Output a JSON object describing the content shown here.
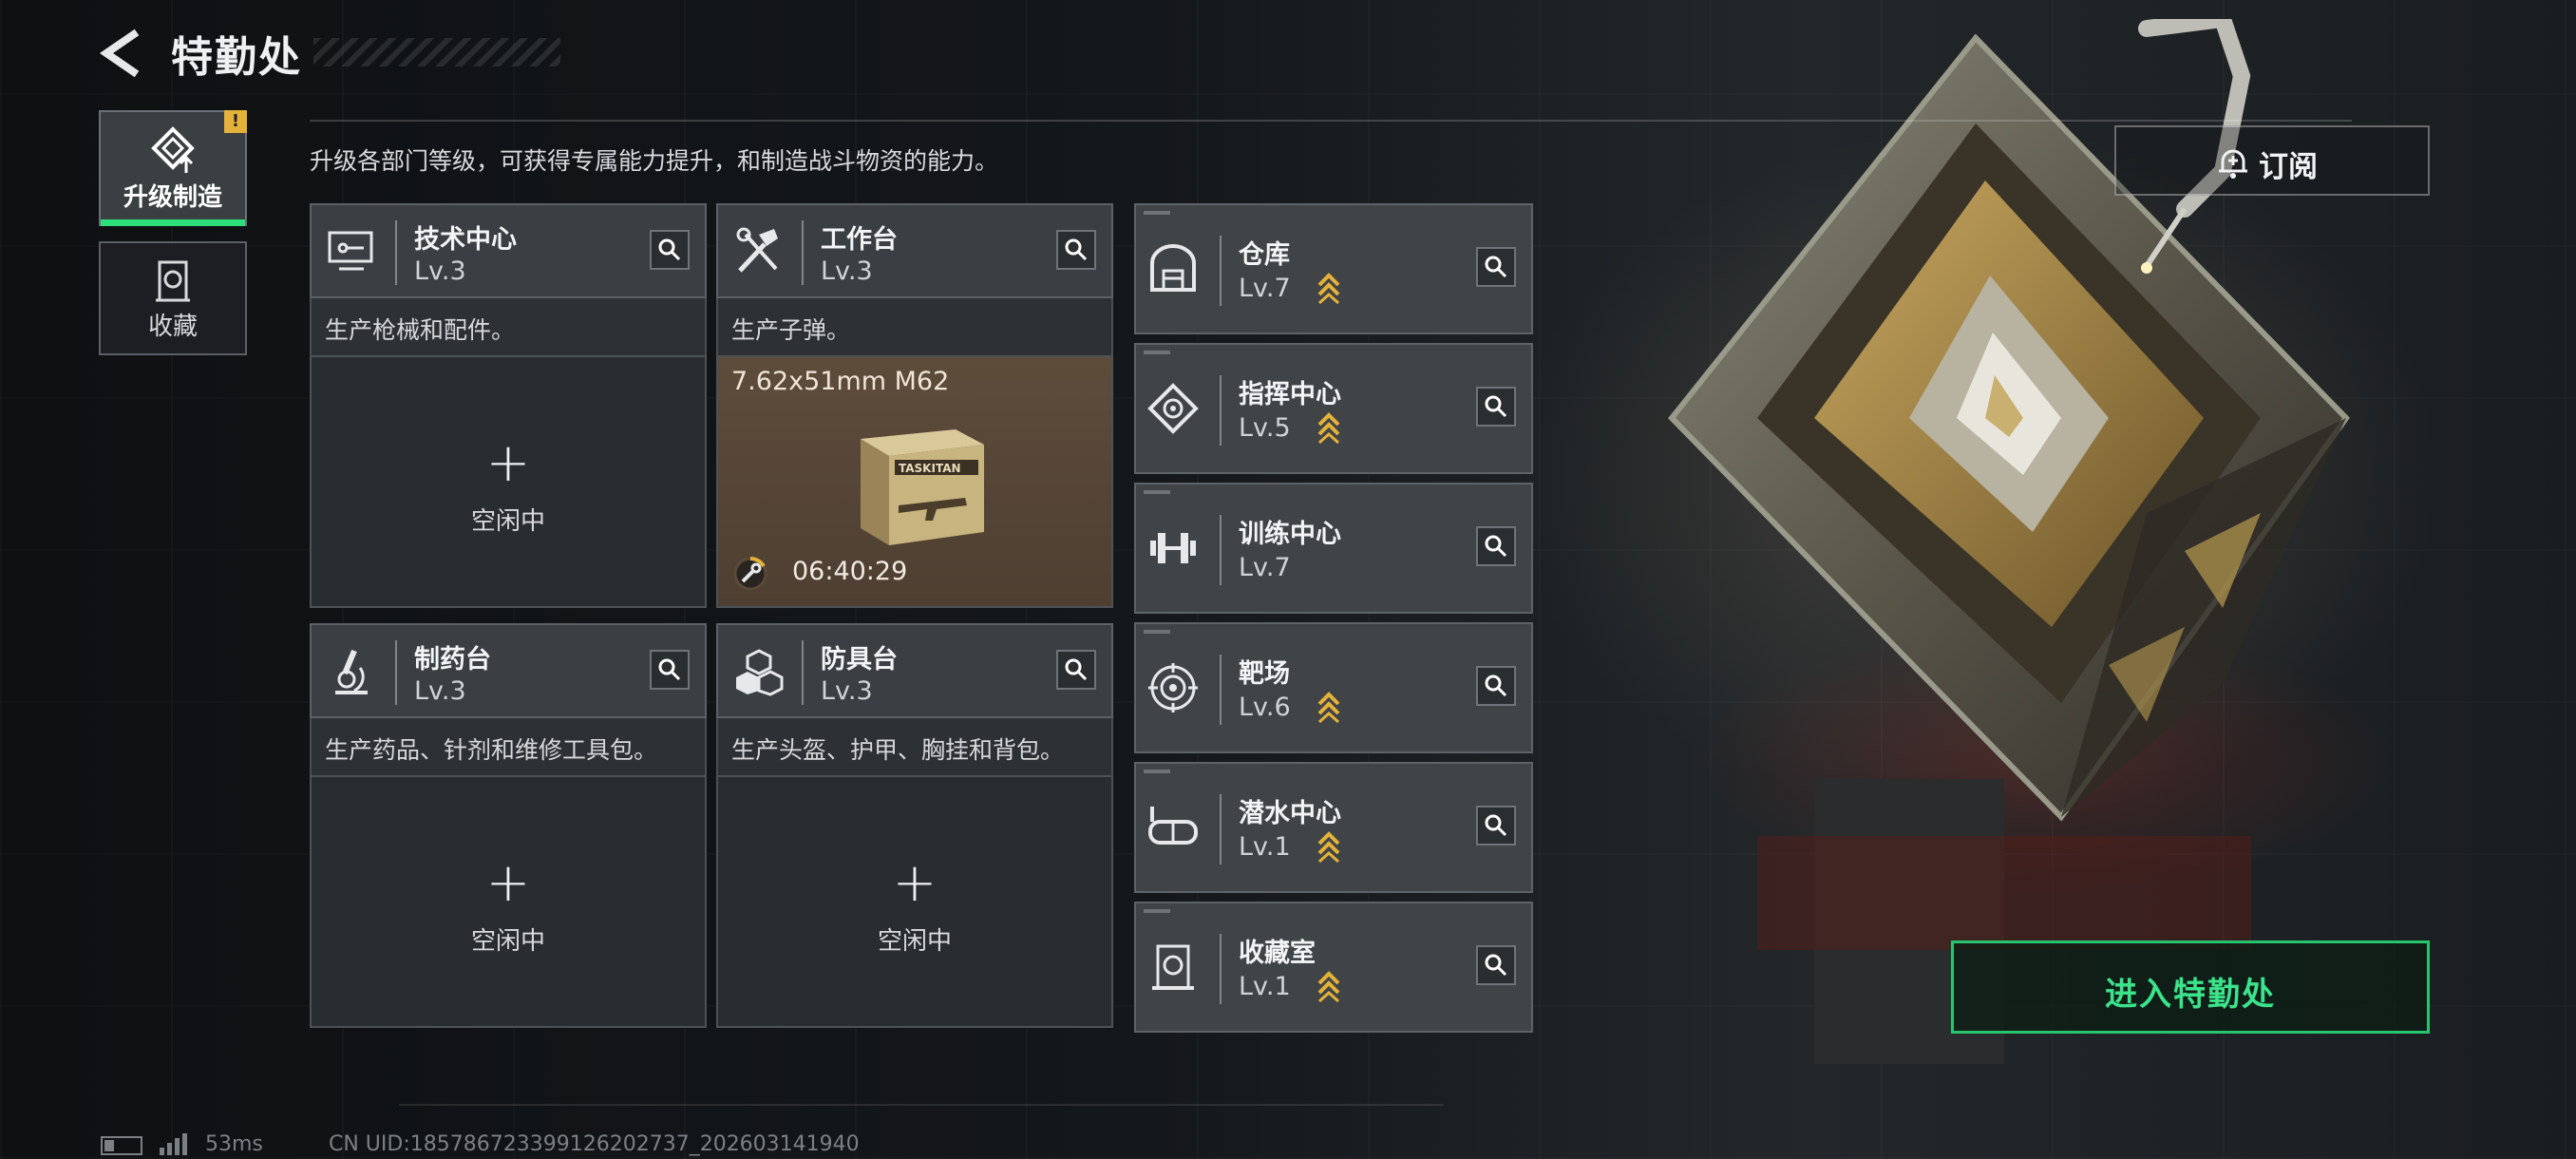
{
  "header": {
    "title": "特勤处",
    "back_icon": "back-arrow-icon"
  },
  "nav": [
    {
      "label": "升级制造",
      "icon": "upgrade-craft-icon",
      "active": true,
      "badge": "!"
    },
    {
      "label": "收藏",
      "icon": "collection-icon",
      "active": false
    }
  ],
  "hint": "升级各部门等级，可获得专属能力提升，和制造战斗物资的能力。",
  "workshops": [
    {
      "name": "技术中心",
      "level": "Lv.3",
      "desc": "生产枪械和配件。",
      "icon": "computer-icon",
      "slot": {
        "state": "idle",
        "label": "空闲中",
        "plus": "+"
      }
    },
    {
      "name": "工作台",
      "level": "Lv.3",
      "desc": "生产子弹。",
      "icon": "tools-icon",
      "slot": {
        "state": "busy",
        "item": "7.62x51mm M62",
        "timer": "06:40:29",
        "box_label": "TASKITAN"
      }
    },
    {
      "name": "制药台",
      "level": "Lv.3",
      "desc": "生产药品、针剂和维修工具包。",
      "icon": "microscope-icon",
      "slot": {
        "state": "idle",
        "label": "空闲中",
        "plus": "+"
      }
    },
    {
      "name": "防具台",
      "level": "Lv.3",
      "desc": "生产头盔、护甲、胸挂和背包。",
      "icon": "armor-icon",
      "slot": {
        "state": "idle",
        "label": "空闲中",
        "plus": "+"
      }
    }
  ],
  "facilities": [
    {
      "name": "仓库",
      "level": "Lv.7",
      "icon": "warehouse-icon",
      "upgradable": true
    },
    {
      "name": "指挥中心",
      "level": "Lv.5",
      "icon": "command-icon",
      "upgradable": true
    },
    {
      "name": "训练中心",
      "level": "Lv.7",
      "icon": "dumbbell-icon",
      "upgradable": false
    },
    {
      "name": "靶场",
      "level": "Lv.6",
      "icon": "target-icon",
      "upgradable": true
    },
    {
      "name": "潜水中心",
      "level": "Lv.1",
      "icon": "diving-mask-icon",
      "upgradable": true
    },
    {
      "name": "收藏室",
      "level": "Lv.1",
      "icon": "collection-room-icon",
      "upgradable": true
    }
  ],
  "subscribe": {
    "label": "订阅",
    "icon": "bell-icon"
  },
  "enter_button": {
    "label": "进入特勤处"
  },
  "footer": {
    "ping": "53ms",
    "uid": "CN UID:185786723399126202737_202603141940"
  },
  "colors": {
    "accent": "#2ee07a",
    "upgrade_chevron": "#e4b23a",
    "badge": "#e4b23a"
  }
}
